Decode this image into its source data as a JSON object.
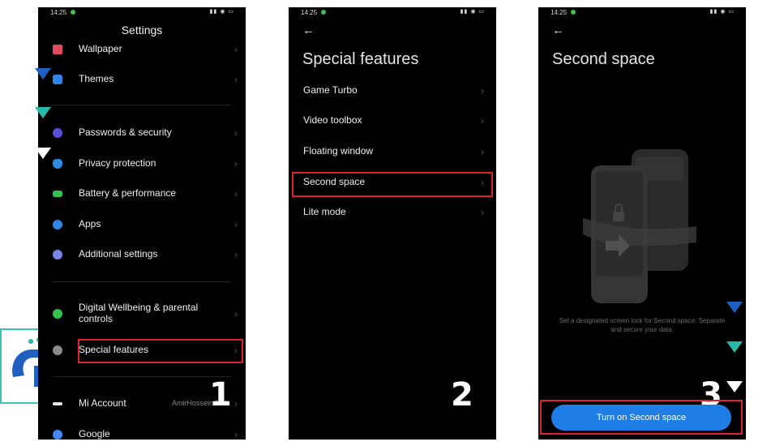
{
  "status_bar": {
    "time": "14:25"
  },
  "screen1": {
    "title": "Settings",
    "items": [
      {
        "label": "Wallpaper",
        "icon": "wallpaper-icon"
      },
      {
        "label": "Themes",
        "icon": "themes-icon"
      },
      {
        "label": "Passwords & security",
        "icon": "lock-icon"
      },
      {
        "label": "Privacy protection",
        "icon": "shield-icon"
      },
      {
        "label": "Battery & performance",
        "icon": "battery-icon"
      },
      {
        "label": "Apps",
        "icon": "gear-icon"
      },
      {
        "label": "Additional settings",
        "icon": "more-icon"
      },
      {
        "label": "Digital Wellbeing & parental controls",
        "icon": "wellbeing-icon"
      },
      {
        "label": "Special features",
        "icon": "star-icon"
      },
      {
        "label": "Mi Account",
        "icon": "mi-icon",
        "value": "AmirHossein Meh"
      },
      {
        "label": "Google",
        "icon": "google-icon"
      }
    ],
    "step": "1"
  },
  "screen2": {
    "title": "Special features",
    "items": [
      {
        "label": "Game Turbo"
      },
      {
        "label": "Video toolbox"
      },
      {
        "label": "Floating window"
      },
      {
        "label": "Second space"
      },
      {
        "label": "Lite mode"
      }
    ],
    "step": "2"
  },
  "screen3": {
    "title": "Second space",
    "description": "Set a designated screen lock for Second space. Separate and secure your data.",
    "button": "Turn on Second space",
    "step": "3"
  },
  "colors": {
    "accent": "#1f7de6",
    "highlight": "#d9232e",
    "marker_blue": "#1f5fbf",
    "marker_teal": "#26b8a8"
  }
}
